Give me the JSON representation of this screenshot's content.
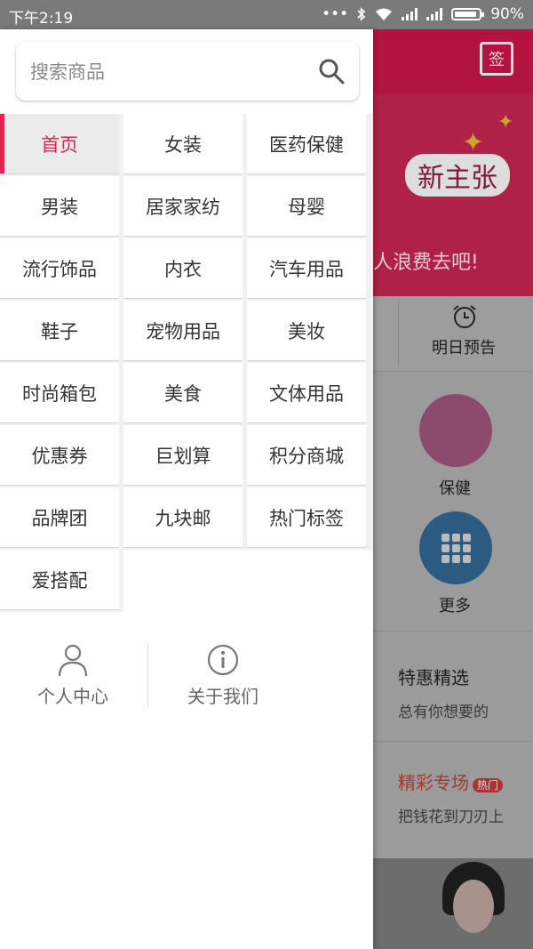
{
  "status_bar": {
    "time": "下午2:19",
    "battery": "90%",
    "battery_level": 0.9
  },
  "search": {
    "placeholder": "搜索商品"
  },
  "categories": [
    "首页",
    "女装",
    "医药保健",
    "男装",
    "居家家纺",
    "母婴",
    "流行饰品",
    "内衣",
    "汽车用品",
    "鞋子",
    "宠物用品",
    "美妆",
    "时尚箱包",
    "美食",
    "文体用品",
    "优惠券",
    "巨划算",
    "积分商城",
    "品牌团",
    "九块邮",
    "热门标签",
    "爱搭配"
  ],
  "active_category": "首页",
  "bottom_links": {
    "profile": "个人中心",
    "about": "关于我们"
  },
  "background": {
    "sign_label": "签",
    "banner_title": "新主张",
    "banner_sub": "人浪费去吧!",
    "tab_tomorrow": "明日预告",
    "cat_health": "保健",
    "cat_more": "更多",
    "sect1_title": "特惠精选",
    "sect1_sub": "总有你想要的",
    "sect2_title": "精彩专场",
    "sect2_badge": "热门",
    "sect2_sub": "把钱花到刀刃上"
  },
  "colors": {
    "accent": "#e4244b",
    "statusbar": "#7a7a7a"
  }
}
